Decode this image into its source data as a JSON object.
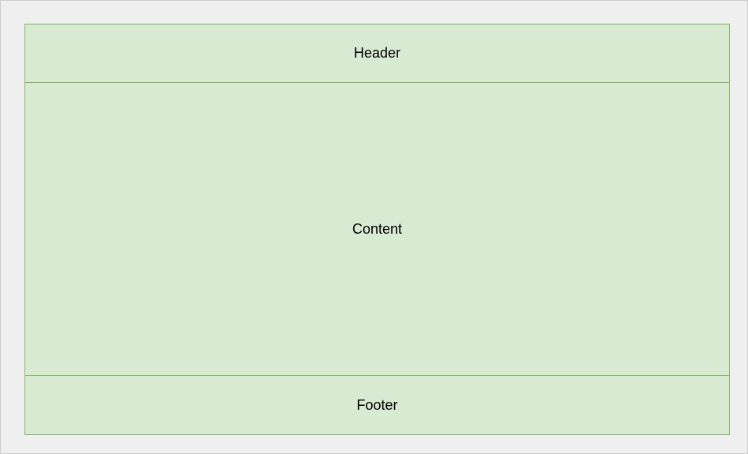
{
  "colors": {
    "canvas_background": "#efefef",
    "box_fill": "#d9ead3",
    "box_stroke": "#82b366",
    "text": "#000000"
  },
  "layout": {
    "header": {
      "label": "Header"
    },
    "content": {
      "label": "Content"
    },
    "footer": {
      "label": "Footer"
    }
  }
}
